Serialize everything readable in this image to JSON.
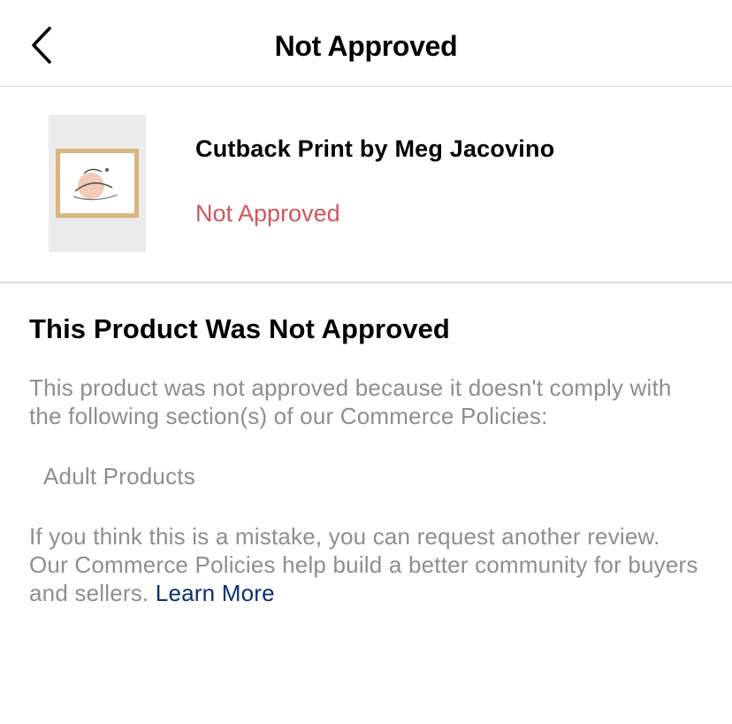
{
  "header": {
    "title": "Not Approved",
    "back_icon": "chevron-left-icon"
  },
  "product": {
    "name": "Cutback Print by Meg Jacovino",
    "status": "Not Approved",
    "status_color": "#d2555e"
  },
  "details": {
    "heading": "This Product Was Not Approved",
    "reason_text": "This product was not approved because it doesn't comply with the following section(s) of our Commerce Policies:",
    "policy_section": "Adult Products",
    "review_text": "If you think this is a mistake, you can request another review.",
    "policies_text": "Our Commerce Policies help build a better community for buyers and sellers.",
    "learn_more_label": "Learn More",
    "link_color": "#0a2e73"
  }
}
